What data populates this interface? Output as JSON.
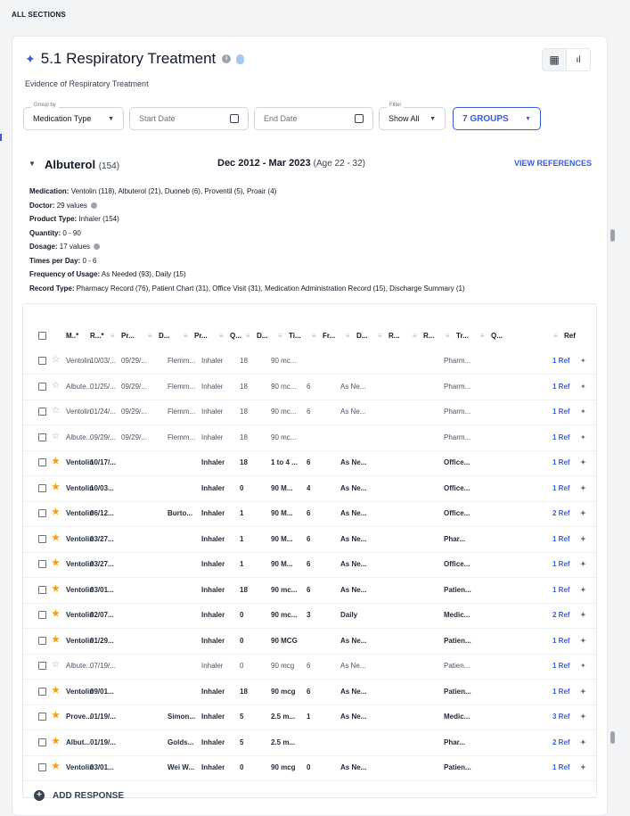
{
  "header": {
    "all_sections": "ALL SECTIONS"
  },
  "section": {
    "title": "5.1 Respiratory Treatment",
    "subtitle": "Evidence of Respiratory Treatment",
    "icons": {
      "title": "sparkle-icon",
      "info": "info-icon",
      "hint": "lightbulb-icon",
      "table_view": "table-icon",
      "chart_view": "bar-chart-icon"
    }
  },
  "controls": {
    "group_by_legend": "Group by",
    "group_by_value": "Medication Type",
    "start_date_placeholder": "Start Date",
    "end_date_placeholder": "End Date",
    "filter_legend": "Filter",
    "filter_value": "Show All",
    "groups_button": "7 GROUPS"
  },
  "group": {
    "name": "Albuterol",
    "count": "(154)",
    "range": "Dec 2012 - Mar 2023",
    "age": "(Age 22 - 32)",
    "view_references": "VIEW REFERENCES",
    "facets": [
      {
        "label": "Medication:",
        "value": "Ventolin (118),  Albuterol (21),  Duoneb (6),  Proventil (5),  Proair (4)"
      },
      {
        "label": "Doctor:",
        "value": "29 values",
        "info": true
      },
      {
        "label": "Product Type:",
        "value": "Inhaler (154)"
      },
      {
        "label": "Quantity:",
        "value": "0 - 90"
      },
      {
        "label": "Dosage:",
        "value": "17 values",
        "info": true
      },
      {
        "label": "Times per Day:",
        "value": "0 - 6"
      },
      {
        "label": "Frequency of Usage:",
        "value": "As Needed (93),  Daily (15)"
      },
      {
        "label": "Record Type:",
        "value": "Pharmacy Record (76),  Patient Chart (31),  Office Visit (31),  Medication Administration Record (15),  Discharge Summary (1)"
      }
    ]
  },
  "table": {
    "headers": [
      "M..*",
      "R...*",
      "Pr...",
      "D...",
      "Pr...",
      "Q...",
      "D...",
      "Ti...",
      "Fr...",
      "D...",
      "R...",
      "R...",
      "Tr...",
      "Q...",
      "Ref"
    ],
    "rows": [
      {
        "star": false,
        "bold": false,
        "med": "Ventolin",
        "r1": "10/03/...",
        "pr1": "09/29/...",
        "doc": "Flemm...",
        "type": "Inhaler",
        "qty": "18",
        "dose": "90 mc...",
        "times": "",
        "freq": "",
        "rec": "Pharm...",
        "ref": "1 Ref"
      },
      {
        "star": false,
        "bold": false,
        "med": "Albute...",
        "r1": "01/25/...",
        "pr1": "09/29/...",
        "doc": "Flemm...",
        "type": "Inhaler",
        "qty": "18",
        "dose": "90 mc...",
        "times": "6",
        "freq": "As Ne...",
        "rec": "Pharm...",
        "ref": "1 Ref"
      },
      {
        "star": false,
        "bold": false,
        "med": "Ventolin",
        "r1": "01/24/...",
        "pr1": "09/29/...",
        "doc": "Flemm...",
        "type": "Inhaler",
        "qty": "18",
        "dose": "90 mc...",
        "times": "6",
        "freq": "As Ne...",
        "rec": "Pharm...",
        "ref": "1 Ref"
      },
      {
        "star": false,
        "bold": false,
        "med": "Albute...",
        "r1": "09/29/...",
        "pr1": "09/29/...",
        "doc": "Flemm...",
        "type": "Inhaler",
        "qty": "18",
        "dose": "90 mc...",
        "times": "",
        "freq": "",
        "rec": "Pharm...",
        "ref": "1 Ref"
      },
      {
        "star": true,
        "bold": true,
        "med": "Ventolin",
        "r1": "10/17/...",
        "pr1": "",
        "doc": "",
        "type": "Inhaler",
        "qty": "18",
        "dose": "1 to 4 ...",
        "times": "6",
        "freq": "As Ne...",
        "rec": "Office...",
        "ref": "1 Ref"
      },
      {
        "star": true,
        "bold": true,
        "med": "Ventolin",
        "r1": "10/03...",
        "pr1": "",
        "doc": "",
        "type": "Inhaler",
        "qty": "0",
        "dose": "90 M...",
        "times": "4",
        "freq": "As Ne...",
        "rec": "Office...",
        "ref": "1 Ref"
      },
      {
        "star": true,
        "bold": true,
        "med": "Ventolin",
        "r1": "06/12...",
        "pr1": "",
        "doc": "Burto...",
        "type": "Inhaler",
        "qty": "1",
        "dose": "90 M...",
        "times": "6",
        "freq": "As Ne...",
        "rec": "Office...",
        "ref": "2 Ref"
      },
      {
        "star": true,
        "bold": true,
        "med": "Ventolin",
        "r1": "03/27...",
        "pr1": "",
        "doc": "",
        "type": "Inhaler",
        "qty": "1",
        "dose": "90 M...",
        "times": "6",
        "freq": "As Ne...",
        "rec": "Phar...",
        "ref": "1 Ref"
      },
      {
        "star": true,
        "bold": true,
        "med": "Ventolin",
        "r1": "03/27...",
        "pr1": "",
        "doc": "",
        "type": "Inhaler",
        "qty": "1",
        "dose": "90 M...",
        "times": "6",
        "freq": "As Ne...",
        "rec": "Office...",
        "ref": "1 Ref"
      },
      {
        "star": true,
        "bold": true,
        "med": "Ventolin",
        "r1": "03/01...",
        "pr1": "",
        "doc": "",
        "type": "Inhaler",
        "qty": "18",
        "dose": "90 mc...",
        "times": "6",
        "freq": "As Ne...",
        "rec": "Patien...",
        "ref": "1 Ref"
      },
      {
        "star": true,
        "bold": true,
        "med": "Ventolin",
        "r1": "02/07...",
        "pr1": "",
        "doc": "",
        "type": "Inhaler",
        "qty": "0",
        "dose": "90 mc...",
        "times": "3",
        "freq": "Daily",
        "rec": "Medic...",
        "ref": "2 Ref"
      },
      {
        "star": true,
        "bold": true,
        "med": "Ventolin",
        "r1": "01/29...",
        "pr1": "",
        "doc": "",
        "type": "Inhaler",
        "qty": "0",
        "dose": "90 MCG",
        "times": "",
        "freq": "As Ne...",
        "rec": "Patien...",
        "ref": "1 Ref"
      },
      {
        "star": false,
        "bold": false,
        "med": "Albute...",
        "r1": "07/19/...",
        "pr1": "",
        "doc": "",
        "type": "Inhaler",
        "qty": "0",
        "dose": "90 mcg",
        "times": "6",
        "freq": "As Ne...",
        "rec": "Patien...",
        "ref": "1 Ref"
      },
      {
        "star": true,
        "bold": true,
        "med": "Ventolin",
        "r1": "09/01...",
        "pr1": "",
        "doc": "",
        "type": "Inhaler",
        "qty": "18",
        "dose": "90 mcg",
        "times": "6",
        "freq": "As Ne...",
        "rec": "Patien...",
        "ref": "1 Ref"
      },
      {
        "star": true,
        "bold": true,
        "med": "Prove...",
        "r1": "01/19/...",
        "pr1": "",
        "doc": "Simon...",
        "type": "Inhaler",
        "qty": "5",
        "dose": "2.5 m...",
        "times": "1",
        "freq": "As Ne...",
        "rec": "Medic...",
        "ref": "3 Ref"
      },
      {
        "star": true,
        "bold": true,
        "med": "Albut...",
        "r1": "01/19/...",
        "pr1": "",
        "doc": "Golds...",
        "type": "Inhaler",
        "qty": "5",
        "dose": "2.5 m...",
        "times": "",
        "freq": "",
        "rec": "Phar...",
        "ref": "2 Ref"
      },
      {
        "star": true,
        "bold": true,
        "med": "Ventolin",
        "r1": "03/01...",
        "pr1": "",
        "doc": "Wei W...",
        "type": "Inhaler",
        "qty": "0",
        "dose": "90 mcg",
        "times": "0",
        "freq": "As Ne...",
        "rec": "Patien...",
        "ref": "1 Ref"
      }
    ]
  },
  "add_response": "ADD RESPONSE"
}
